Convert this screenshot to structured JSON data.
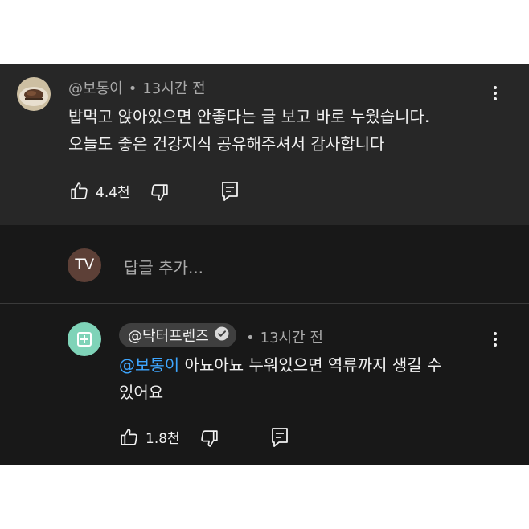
{
  "comment": {
    "author": "@보통이",
    "time": "13시간 전",
    "lines": [
      "밥먹고 앉아있으면 안좋다는 글 보고 바로 누웠습니다.",
      "오늘도 좋은 건강지식 공유해주셔서 감사합니다"
    ],
    "likes": "4.4천",
    "avatar_icon": "food-photo",
    "like_icon": "thumb-up-icon",
    "dislike_icon": "thumb-down-icon",
    "reply_icon": "comment-icon",
    "menu_icon": "more-vert-icon"
  },
  "reply_box": {
    "avatar_text": "TV",
    "placeholder": "답글 추가..."
  },
  "reply": {
    "author": "@닥터프렌즈",
    "verified": true,
    "time": "13시간 전",
    "mention": "@보통이",
    "line1_rest": " 아뇨아뇨 누워있으면 역류까지 생길 수",
    "line2": "있어요",
    "likes": "1.8천"
  },
  "colors": {
    "comment_bg": "#272727",
    "reply_bg": "#181818",
    "mention": "#3ea6ff",
    "reply_avatar": "#7fd3b8",
    "tv_avatar": "#5d4037"
  }
}
